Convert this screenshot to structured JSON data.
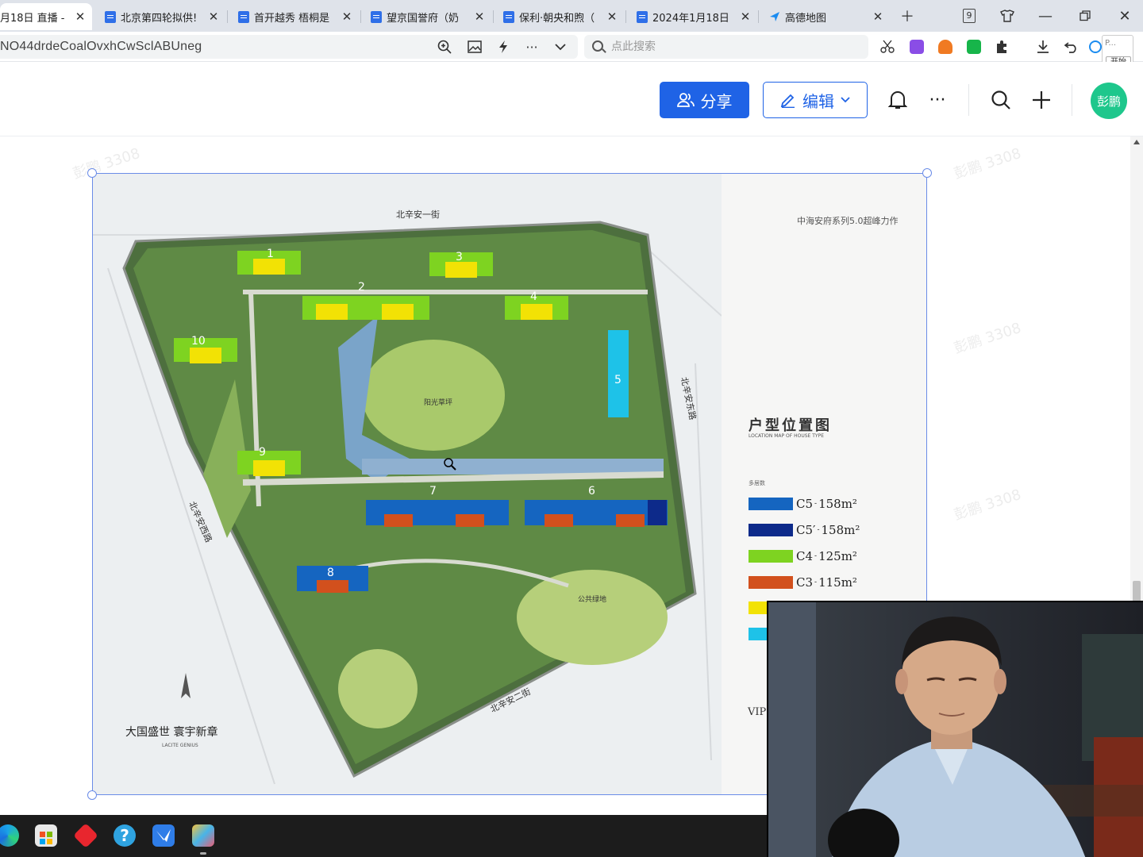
{
  "tabs": [
    {
      "label": "月18日 直播 -"
    },
    {
      "label": "北京第四轮拟供!"
    },
    {
      "label": "首开越秀 梧桐是"
    },
    {
      "label": "望京国誉府（奶"
    },
    {
      "label": "保利·朝央和煦（"
    },
    {
      "label": "2024年1月18日"
    },
    {
      "label": "高德地图"
    }
  ],
  "tab_count_badge": "9",
  "address": {
    "url": "NO44drdeCoalOvxhCwSclABUneg",
    "search_placeholder": "点此搜索"
  },
  "popup": {
    "title": "P...",
    "button": "开始"
  },
  "header": {
    "share_label": "分享",
    "edit_label": "编辑",
    "avatar_text": "彭鹏"
  },
  "watermark_text": "彭鹏 3308",
  "plan": {
    "street_top": "北辛安一街",
    "street_right": "北辛安东路",
    "street_left": "北辛安西路",
    "street_bottom": "北辛安二街",
    "center_label": "阳光草坪",
    "lawn_label": "公共绿地",
    "slogan": "大国盛世  寰宇新章",
    "slogan_sub": "LACITE GENIUS",
    "brand_line": "中海安府系列5.0超峰力作",
    "legend_title": "户型位置图",
    "legend_subtitle": "LOCATION MAP OF HOUSE TYPE",
    "legend_heading": "多居数",
    "vip_label": "VIP:",
    "buildings": [
      "1",
      "2",
      "3",
      "4",
      "5",
      "6",
      "7",
      "8",
      "9",
      "10"
    ],
    "legend": [
      {
        "code": "C5",
        "area": "158m²",
        "color": "#1565c0"
      },
      {
        "code": "C5′",
        "area": "158m²",
        "color": "#0d2a8a"
      },
      {
        "code": "C4",
        "area": "125m²",
        "color": "#7ed321"
      },
      {
        "code": "C3",
        "area": "115m²",
        "color": "#d2501d"
      },
      {
        "code": "",
        "area": "",
        "color": "#f2e205"
      },
      {
        "code": "",
        "area": "",
        "color": "#1ec2e8"
      }
    ]
  }
}
